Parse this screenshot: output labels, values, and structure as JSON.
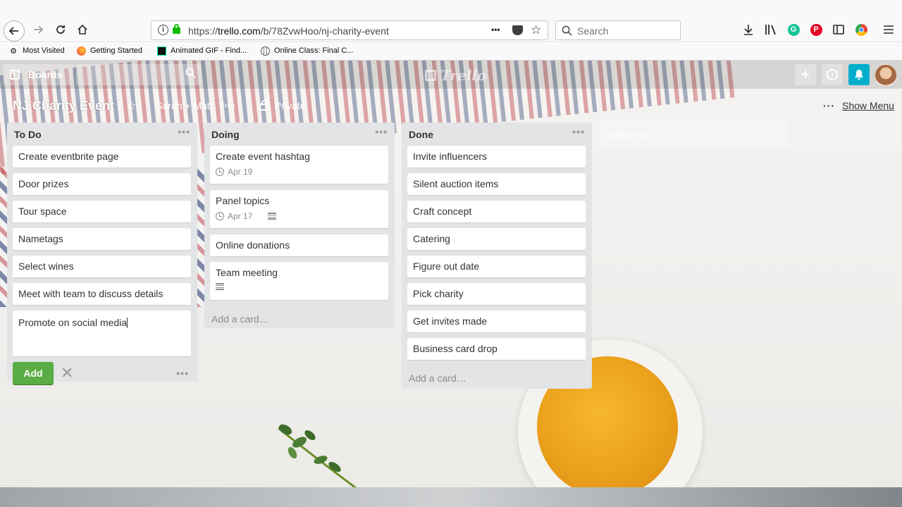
{
  "browser": {
    "url_prefix": "https://",
    "url_host": "trello.com",
    "url_path": "/b/78ZvwHoo/nj-charity-event",
    "url_overflow": "•••",
    "search_placeholder": "Search",
    "bookmarks": [
      {
        "label": "Most Visited",
        "icon": "gear-icon"
      },
      {
        "label": "Getting Started",
        "icon": "firefox-icon"
      },
      {
        "label": "Animated GIF - Find...",
        "icon": "giphy-icon"
      },
      {
        "label": "Online Class: Final C...",
        "icon": "globe-icon"
      }
    ]
  },
  "trello": {
    "boards_label": "Boards",
    "logo_text": "Trello",
    "board_title": "NJ Charity Event",
    "team_name": "Sarah + Matt",
    "team_tier": "Free",
    "privacy": "Private",
    "show_menu": "Show Menu",
    "add_list_placeholder": "Add a list…",
    "accent_color": "#5aac44",
    "notification_color": "#00aecc"
  },
  "lists": [
    {
      "title": "To Do",
      "cards": [
        {
          "title": "Create eventbrite page"
        },
        {
          "title": "Door prizes"
        },
        {
          "title": "Tour space"
        },
        {
          "title": "Nametags"
        },
        {
          "title": "Select wines"
        },
        {
          "title": "Meet with team to discuss details"
        }
      ],
      "composer": {
        "value": "Promote on social media",
        "add_label": "Add",
        "close": "✕",
        "more": "•••"
      }
    },
    {
      "title": "Doing",
      "cards": [
        {
          "title": "Create event hashtag",
          "due": "Apr 19"
        },
        {
          "title": "Panel topics",
          "due": "Apr 17"
        },
        {
          "title": "Online donations"
        },
        {
          "title": "Team meeting"
        }
      ],
      "add_card": "Add a card…"
    },
    {
      "title": "Done",
      "cards": [
        {
          "title": "Invite influencers"
        },
        {
          "title": "Silent auction items"
        },
        {
          "title": "Craft concept"
        },
        {
          "title": "Catering"
        },
        {
          "title": "Figure out date"
        },
        {
          "title": "Pick charity"
        },
        {
          "title": "Get invites made"
        },
        {
          "title": "Business card drop"
        }
      ],
      "add_card": "Add a card…"
    }
  ],
  "list_menu": "•••"
}
